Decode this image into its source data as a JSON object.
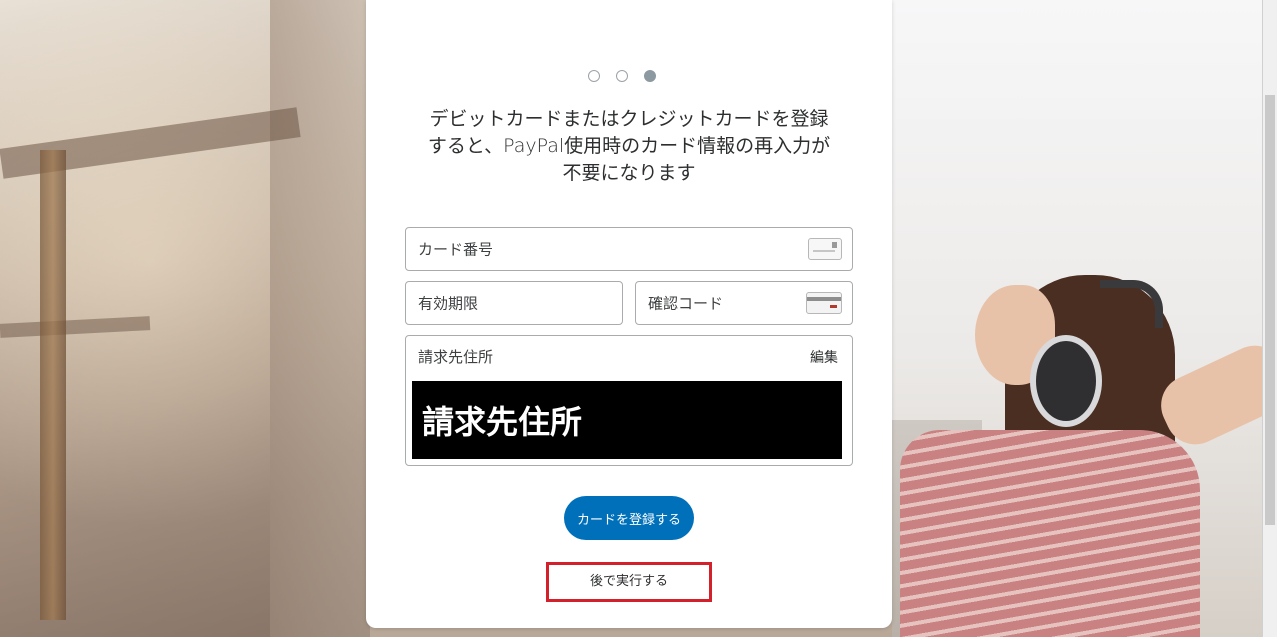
{
  "onboarding": {
    "steps_total": 3,
    "active_step": 3,
    "headline": "デビットカードまたはクレジットカードを登録すると、PayPal使用時のカード情報の再入力が不要になります"
  },
  "form": {
    "card_number_placeholder": "カード番号",
    "expiry_placeholder": "有効期限",
    "security_code_placeholder": "確認コード",
    "billing_address_label": "請求先住所",
    "billing_address_edit": "編集",
    "billing_address_value": "請求先住所"
  },
  "actions": {
    "register_card_label": "カードを登録する",
    "later_label": "後で実行する"
  },
  "colors": {
    "primary_button": "#0070ba",
    "highlight_box": "#d3202a"
  }
}
